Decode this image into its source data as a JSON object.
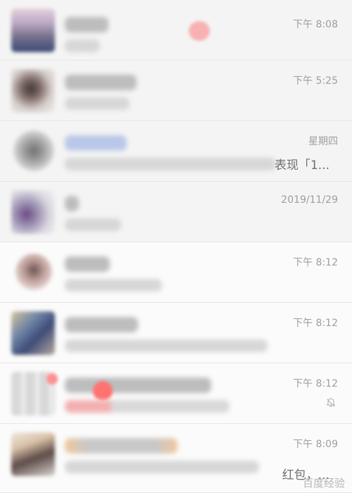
{
  "chat_list": {
    "items": [
      {
        "time": "下午 8:08",
        "snippet": "",
        "muted": false
      },
      {
        "time": "下午 5:25",
        "snippet": "",
        "muted": false
      },
      {
        "time": "星期四",
        "snippet": "表现「1...",
        "muted": false
      },
      {
        "time": "2019/11/29",
        "snippet": "",
        "muted": false
      },
      {
        "time": "下午 8:12",
        "snippet": "",
        "muted": false
      },
      {
        "time": "下午 8:12",
        "snippet": "",
        "muted": false
      },
      {
        "time": "下午 8:12",
        "snippet": "",
        "muted": true
      },
      {
        "time": "下午 8:09",
        "snippet": "红包，...",
        "muted": false
      }
    ]
  },
  "watermark": {
    "text": "百度经验"
  },
  "icons": {
    "mute": "bell-off-icon"
  },
  "colors": {
    "background": "#f7f7f7",
    "time_text": "#9e9e9e",
    "divider": "#e6e6e6",
    "unread_red": "#f35d5d"
  }
}
